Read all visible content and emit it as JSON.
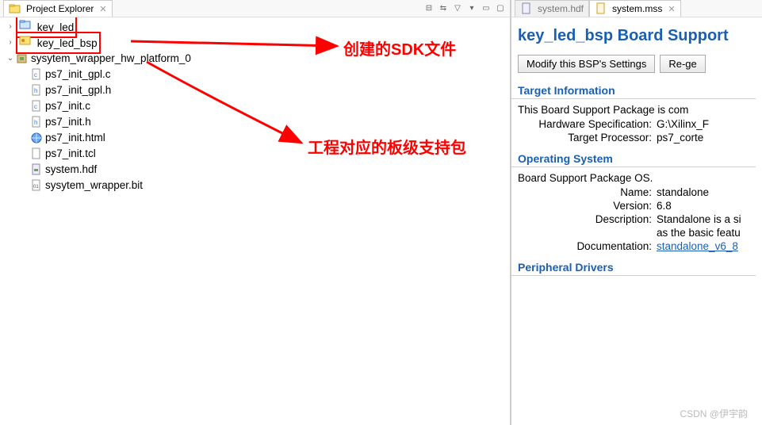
{
  "left": {
    "title": "Project Explorer",
    "items": {
      "key_led": "key_led",
      "key_led_bsp": "key_led_bsp",
      "hw_platform": "sysytem_wrapper_hw_platform_0",
      "files": [
        "ps7_init_gpl.c",
        "ps7_init_gpl.h",
        "ps7_init.c",
        "ps7_init.h",
        "ps7_init.html",
        "ps7_init.tcl",
        "system.hdf",
        "sysytem_wrapper.bit"
      ]
    }
  },
  "right": {
    "tabs": {
      "hdf": "system.hdf",
      "mss": "system.mss"
    },
    "title": "key_led_bsp Board Support",
    "buttons": {
      "modify": "Modify this BSP's Settings",
      "regen": "Re-ge"
    },
    "sections": {
      "target": "Target Information",
      "os": "Operating System",
      "periph": "Peripheral Drivers"
    },
    "target_text": "This Board Support Package is com",
    "hw_spec_label": "Hardware Specification:",
    "hw_spec_val": "G:\\Xilinx_F",
    "tgt_proc_label": "Target Processor:",
    "tgt_proc_val": "ps7_corte",
    "os_text": "Board Support Package OS.",
    "name_label": "Name:",
    "name_val": "standalone",
    "version_label": "Version:",
    "version_val": "6.8",
    "desc_label": "Description:",
    "desc_val1": "Standalone is a si",
    "desc_val2": "as the basic featu",
    "doc_label": "Documentation:",
    "doc_val": "standalone_v6_8"
  },
  "annotations": {
    "sdk": "创建的SDK文件",
    "bsp": "工程对应的板级支持包"
  },
  "watermark": "CSDN @伊宇韵"
}
